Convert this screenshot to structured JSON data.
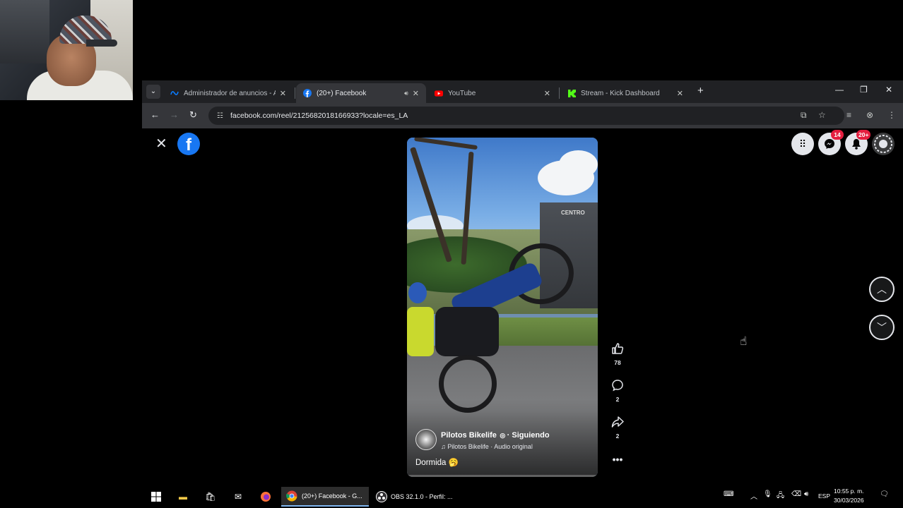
{
  "browser": {
    "tabs": [
      {
        "title": "Administrador de anuncios - A",
        "favicon": "meta-icon",
        "active": false
      },
      {
        "title": "(20+) Facebook",
        "favicon": "facebook-icon",
        "active": true,
        "audio": true
      },
      {
        "title": "YouTube",
        "favicon": "youtube-icon",
        "active": false
      },
      {
        "title": "Stream - Kick Dashboard",
        "favicon": "kick-icon",
        "active": false
      }
    ],
    "url": "facebook.com/reel/2125682018166933?locale=es_LA"
  },
  "page": {
    "badges": {
      "messenger": "14",
      "notifications": "20+"
    },
    "reel": {
      "author": "Pilotos Bikelife",
      "follow_status": "· Siguiendo",
      "audio": "♫ Pilotos Bikelife · Audio original",
      "caption": "Dormida 🥱",
      "building_text": "CENTRO",
      "progress": 0.0
    },
    "actions": {
      "likes": "78",
      "comments": "2",
      "shares": "2"
    }
  },
  "taskbar": {
    "apps": [
      {
        "label": "(20+) Facebook - G...",
        "icon": "chrome-icon",
        "active": true
      },
      {
        "label": "OBS 32.1.0 - Perfil: ...",
        "icon": "obs-icon",
        "active": false
      }
    ],
    "language": "ESP",
    "time": "10:55 p. m.",
    "date": "30/03/2026"
  },
  "colors": {
    "facebook_blue": "#1877f2",
    "badge_red": "#e41e3f",
    "chrome_dark": "#202124",
    "toolbar_dark": "#35363a"
  }
}
